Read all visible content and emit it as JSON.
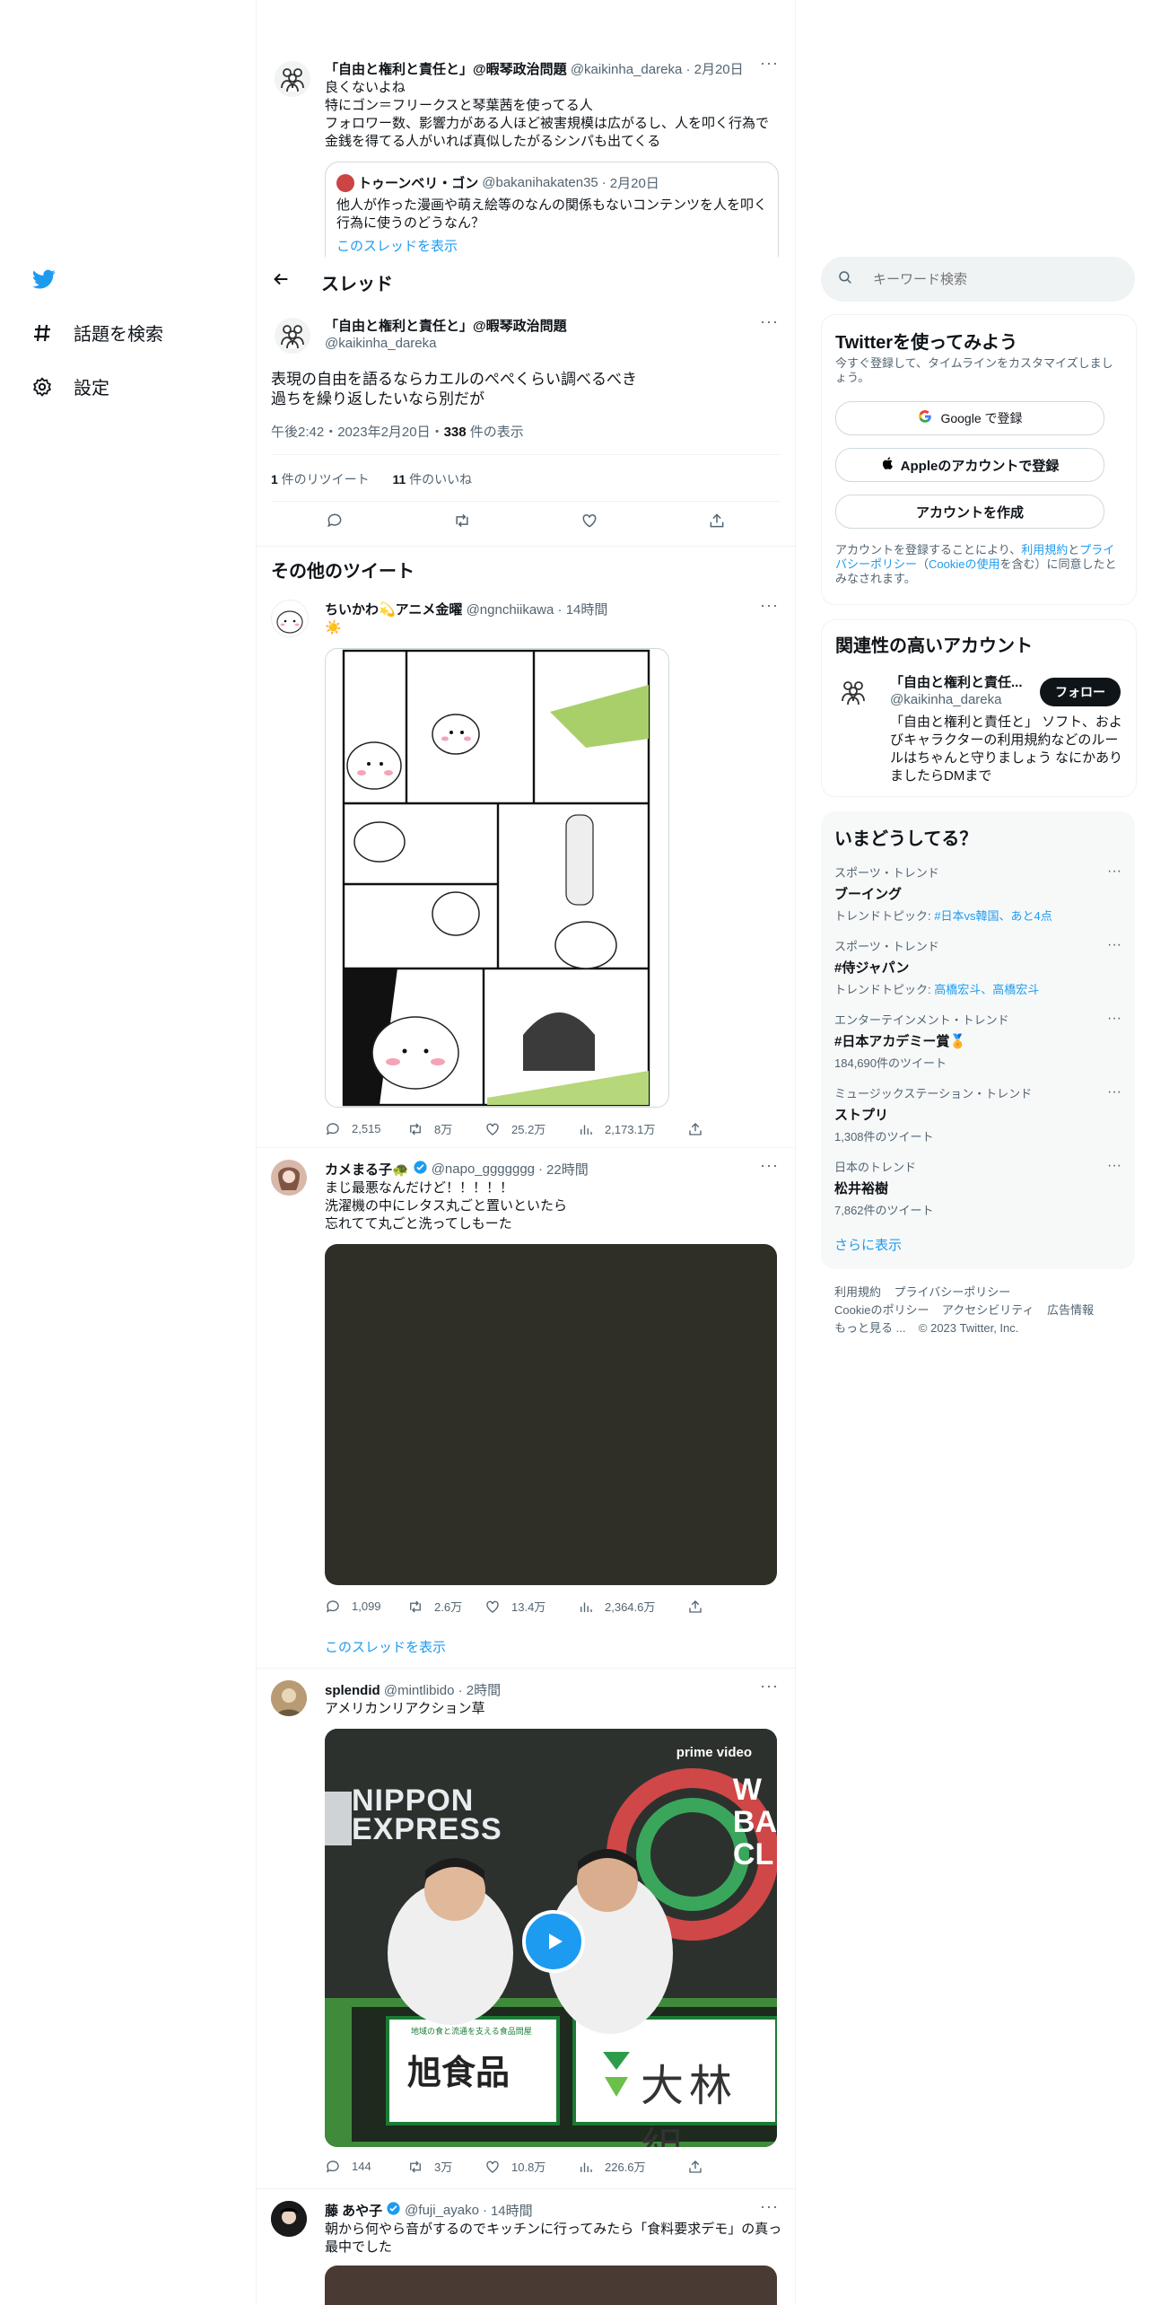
{
  "nav": {
    "items": [
      {
        "label": "話題を検索",
        "icon": "hashtag-icon"
      },
      {
        "label": "設定",
        "icon": "gear-icon"
      }
    ]
  },
  "prev_tweet": {
    "name": "「自由と権利と責任と」@暇琴政治問題",
    "handle": "@kaikinha_dareka",
    "time": "2月20日",
    "text": "良くないよね\n特にゴン＝フリークスと琴葉茜を使ってる人\nフォロワー数、影響力がある人ほど被害規模は広がるし、人を叩く行為で\n金銭を得てる人がいれば真似したがるシンパも出てくる",
    "quote": {
      "name": "トゥーンベリ・ゴン",
      "handle": "@bakanihakaten35",
      "time": "2月20日",
      "text": "他人が作った漫画や萌え絵等のなんの関係もないコンテンツを人を叩く\n行為に使うのどうなん？",
      "thread_link": "このスレッドを表示"
    }
  },
  "header": {
    "title": "スレッド"
  },
  "main_tweet": {
    "name": "「自由と権利と責任と」@暇琴政治問題",
    "handle": "@kaikinha_dareka",
    "text": "表現の自由を語るならカエルのぺぺくらい調べるべき\n過ちを繰り返したいなら別だが",
    "meta": "午後2:42・2023年2月20日・",
    "views_count": "338",
    "views_label": " 件の表示",
    "retweets_count": "1",
    "retweets_label": " 件のリツイート",
    "likes_count": "11",
    "likes_label": " 件のいいね"
  },
  "more_tweets_heading": "その他のツイート",
  "tweets": [
    {
      "name": "ちいかわ💫アニメ金曜",
      "handle": "@ngnchiikawa",
      "time": "14時間",
      "text": "☀️",
      "replies": "2,515",
      "retweets": "8万",
      "likes": "25.2万",
      "views": "2,173.1万"
    },
    {
      "name": "カメまる子🐢",
      "handle": "@napo_ggggggg",
      "time": "22時間",
      "text": "まじ最悪なんだけど！！！！！\n洗濯機の中にレタス丸ごと置いといたら\n忘れてて丸ごと洗ってしもーた",
      "replies": "1,099",
      "retweets": "2.6万",
      "likes": "13.4万",
      "views": "2,364.6万",
      "thread_link": "このスレッドを表示"
    },
    {
      "name": "splendid",
      "handle": "@mintlibido",
      "time": "2時間",
      "text": "アメリカンリアクション草",
      "replies": "144",
      "retweets": "3万",
      "likes": "10.8万",
      "views": "226.6万",
      "video": {
        "brand": "prime video",
        "banner_left": "NIPPON",
        "banner_left2": "EXPRESS",
        "board1": "旭食品",
        "board1_small": "地域の食と流通を支える食品問屋",
        "board2": "大林組",
        "side_text": "W\nBA\nCL"
      }
    },
    {
      "name": "藤 あや子",
      "handle": "@fuji_ayako",
      "time": "14時間",
      "text": "朝から何やら音がするのでキッチンに行ってみたら「食料要求デモ」の真っ\n最中でした"
    }
  ],
  "search": {
    "placeholder": "キーワード検索"
  },
  "signup": {
    "title": "Twitterを使ってみよう",
    "desc": "今すぐ登録して、タイムラインをカスタマイズしましょう。",
    "google": "Google で登録",
    "apple": "Appleのアカウントで登録",
    "create": "アカウントを作成",
    "terms_prefix": "アカウントを登録することにより、",
    "terms_link": "利用規約",
    "terms_mid": "と",
    "privacy_link": "プライバシーポリシー",
    "cookie_open": "（",
    "cookie_link": "Cookieの使用",
    "terms_suffix": "を含む）に同意したとみなされます。"
  },
  "related": {
    "title": "関連性の高いアカウント",
    "name": "「自由と権利と責任...",
    "handle": "@kaikinha_dareka",
    "follow": "フォロー",
    "bio": "「自由と権利と責任と」 ソフト、およびキャラクターの利用規約などのルールはちゃんと守りましょう なにかありましたらDMまで"
  },
  "trends": {
    "title": "いまどうしてる？",
    "items": [
      {
        "category": "スポーツ・トレンド",
        "name": "ブーイング",
        "sub_prefix": "トレンドトピック: ",
        "sub_link": "#日本vs韓国、あと4点"
      },
      {
        "category": "スポーツ・トレンド",
        "name": "#侍ジャパン",
        "sub_prefix": "トレンドトピック: ",
        "sub_link": "高橋宏斗、高橋宏斗"
      },
      {
        "category": "エンターテインメント・トレンド",
        "name": "#日本アカデミー賞🏅",
        "sub_plain": "184,690件のツイート"
      },
      {
        "category": "ミュージックステーション・トレンド",
        "name": "ストプリ",
        "sub_plain": "1,308件のツイート"
      },
      {
        "category": "日本のトレンド",
        "name": "松井裕樹",
        "sub_plain": "7,862件のツイート"
      }
    ],
    "show_more": "さらに表示"
  },
  "footer": {
    "line1": [
      "利用規約",
      "プライバシーポリシー"
    ],
    "line2": [
      "Cookieのポリシー",
      "アクセシビリティ",
      "広告情報"
    ],
    "line3_more": "もっと見る ...",
    "copyright": "© 2023 Twitter, Inc."
  }
}
